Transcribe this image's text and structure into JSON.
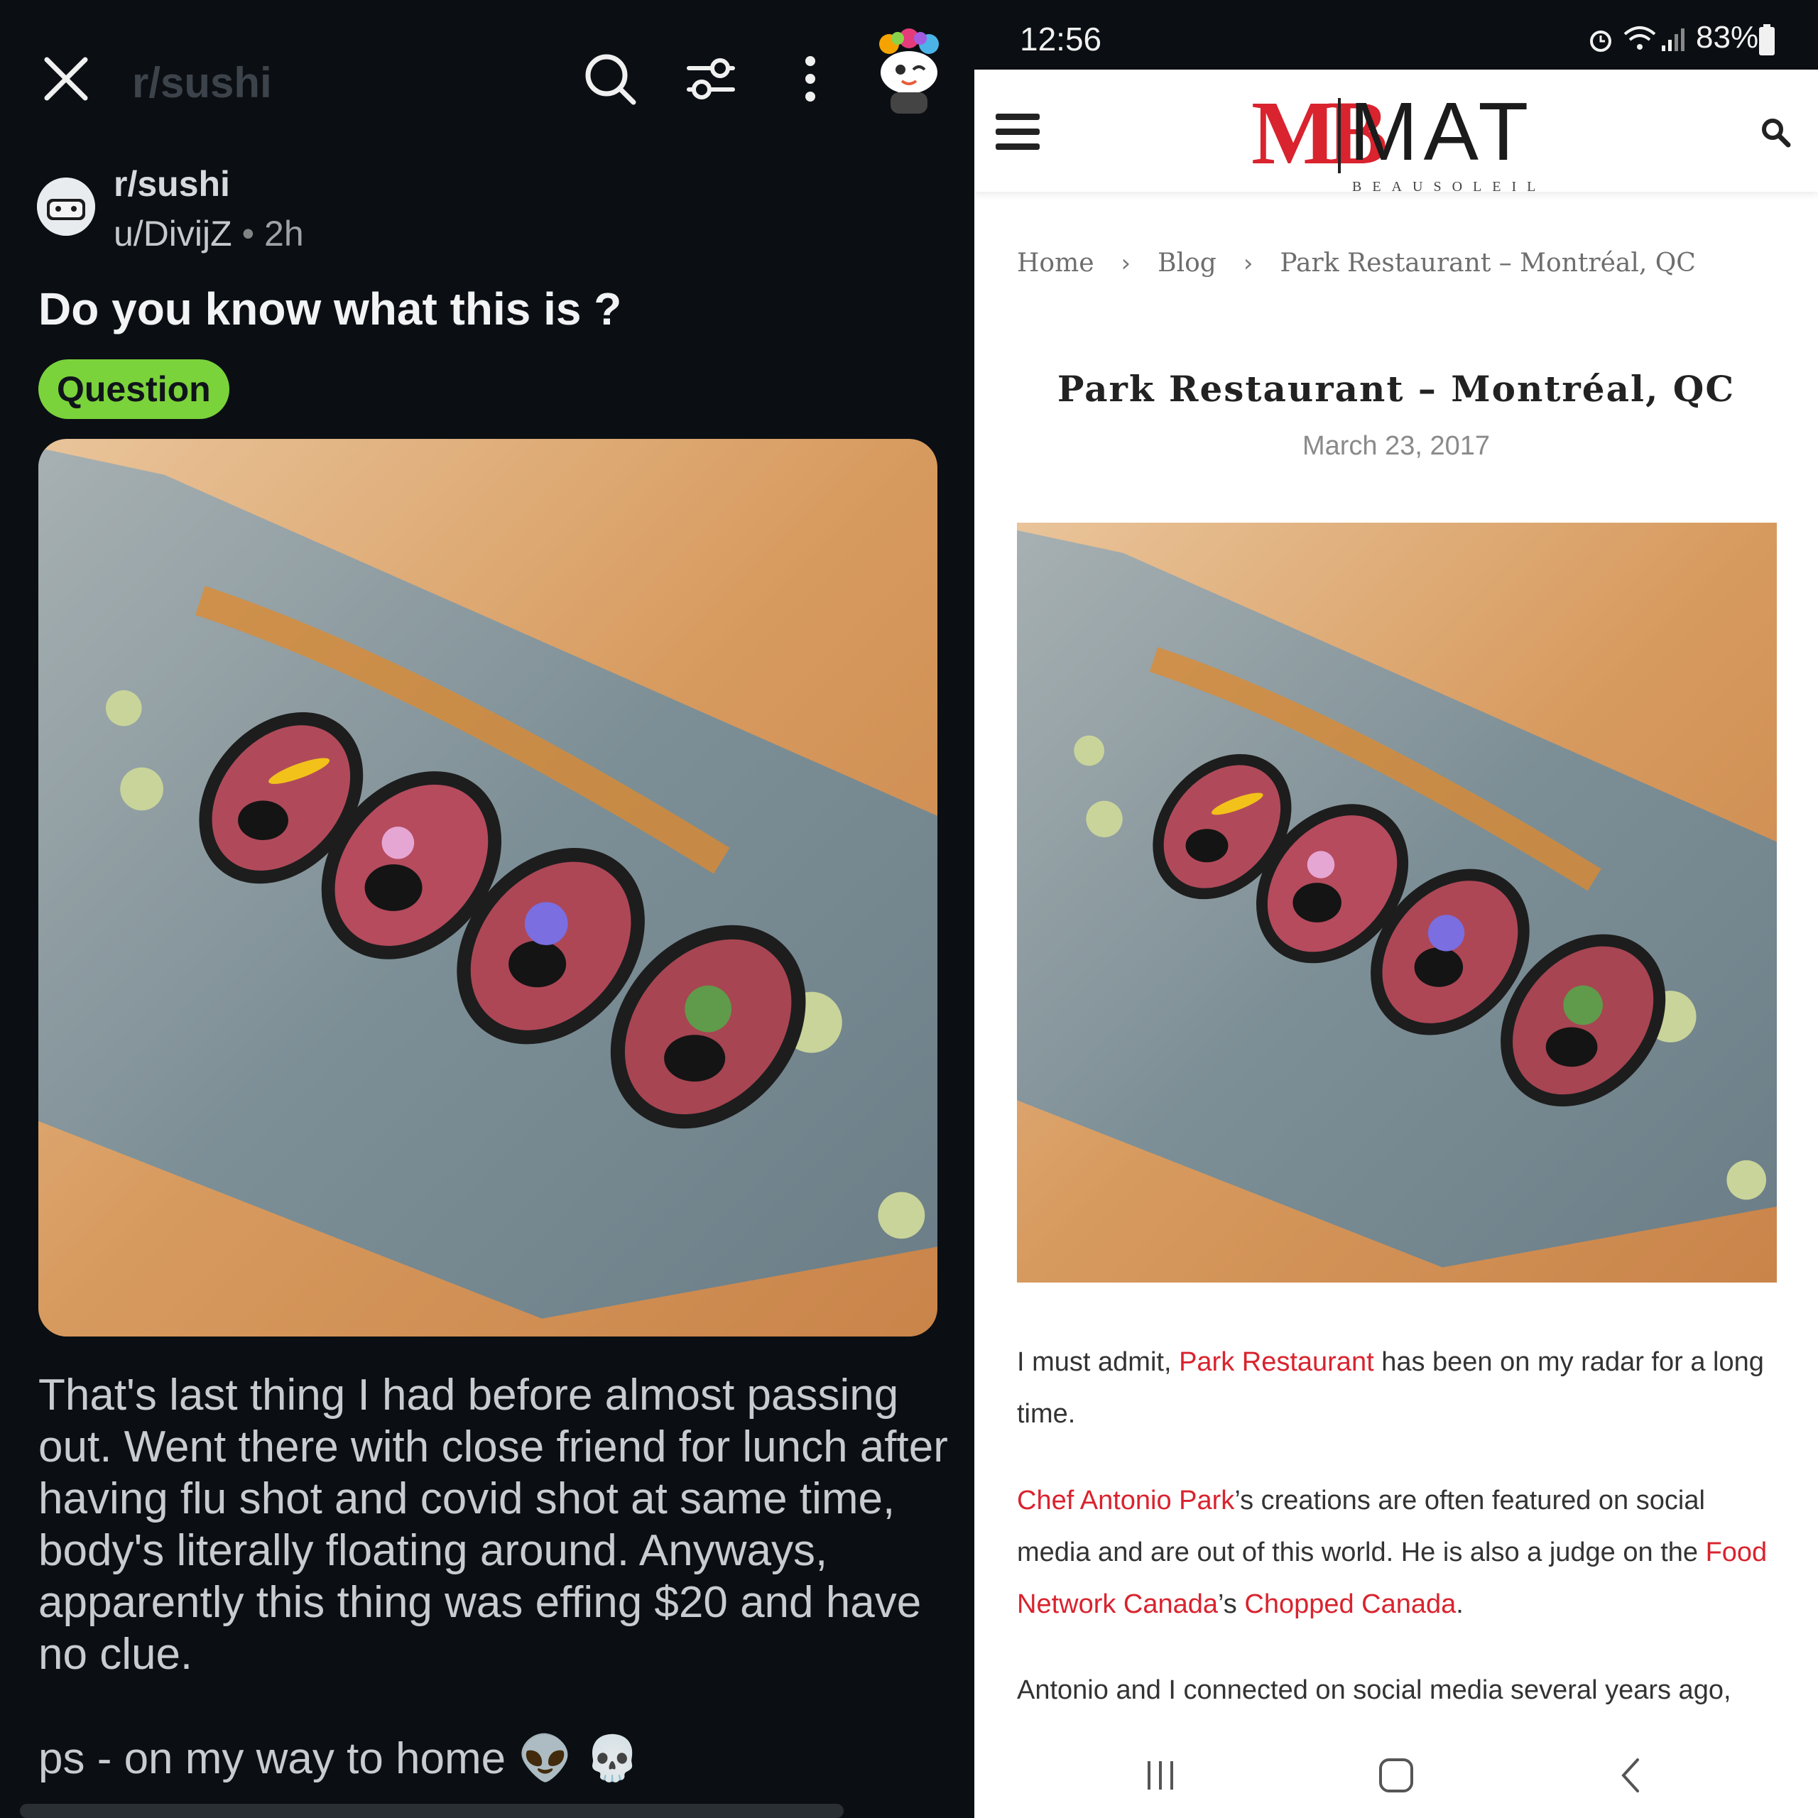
{
  "reddit": {
    "header": {
      "subreddit": "r/sushi"
    },
    "post": {
      "subreddit": "r/sushi",
      "author": "u/DivijZ",
      "separator": "•",
      "age": "2h",
      "title": "Do you know what this is ?",
      "flair": "Question",
      "body": "That's last thing I had before almost passing out. Went there with close friend for lunch after having flu shot and covid shot at same time, body's literally floating around. Anyways, apparently this thing was effing $20 and have no clue.",
      "ps": "ps - on my way to home 👽 💀"
    },
    "icons": [
      "close-icon",
      "search-icon",
      "filter-icon",
      "more-vertical-icon",
      "avatar"
    ]
  },
  "phone": {
    "status": {
      "time": "12:56",
      "battery": "83%"
    }
  },
  "blog": {
    "logo": {
      "mark": "MB",
      "name": "MAT",
      "sub": "BEAUSOLEIL"
    },
    "breadcrumb": {
      "home": "Home",
      "sep": "›",
      "blog": "Blog",
      "current": "Park Restaurant – Montréal, QC"
    },
    "title": "Park Restaurant – Montréal, QC",
    "date": "March 23, 2017",
    "p1": {
      "pre": "I must admit, ",
      "link": "Park Restaurant",
      "post": " has been on my radar for a long time."
    },
    "p2": {
      "link1": "Chef Antonio Park",
      "mid1": "’s creations are often featured on social media and are out of this world. He is also a judge on the ",
      "link2": "Food Network Canada",
      "mid2": "’s ",
      "link3": "Chopped Canada",
      "end": "."
    },
    "p3": "Antonio and I connected on social media several years ago,"
  },
  "colors": {
    "brand_red": "#d9232e",
    "flair_green": "#7bd33b",
    "dark_bg": "#0b0f13"
  }
}
